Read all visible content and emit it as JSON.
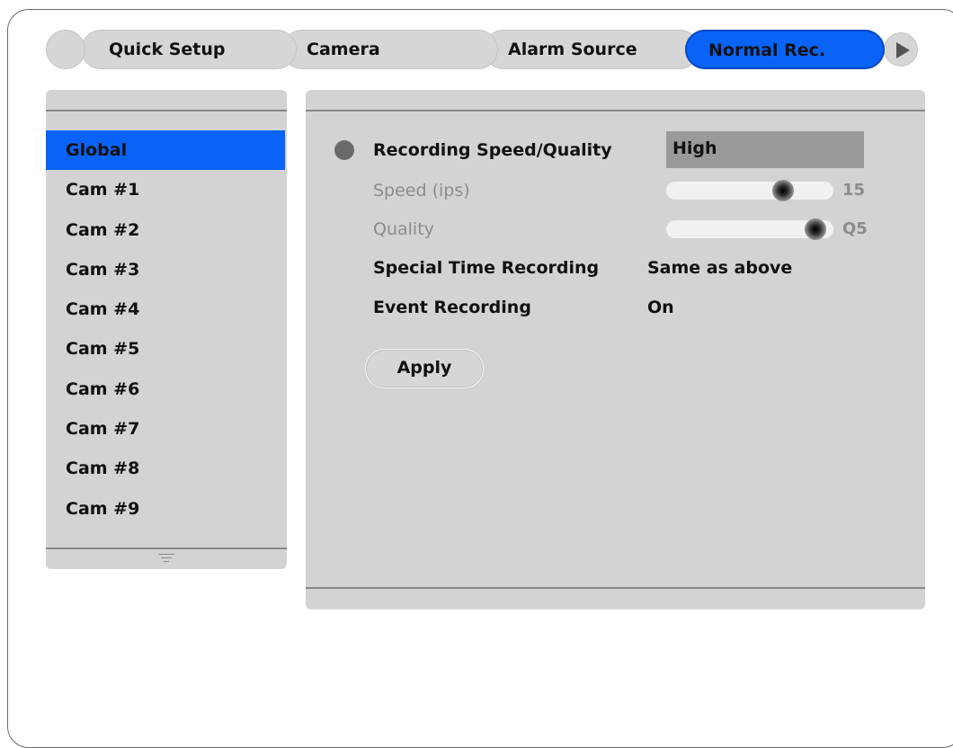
{
  "tabs": [
    {
      "label": "Quick Setup"
    },
    {
      "label": "Camera"
    },
    {
      "label": "Alarm Source"
    },
    {
      "label": "Normal Rec.",
      "active": true
    }
  ],
  "sidebar": {
    "items": [
      {
        "label": "Global",
        "selected": true
      },
      {
        "label": "Cam #1"
      },
      {
        "label": "Cam #2"
      },
      {
        "label": "Cam #3"
      },
      {
        "label": "Cam #4"
      },
      {
        "label": "Cam #5"
      },
      {
        "label": "Cam #6"
      },
      {
        "label": "Cam #7"
      },
      {
        "label": "Cam #8"
      },
      {
        "label": "Cam #9"
      }
    ]
  },
  "settings": {
    "recording_speed_quality": {
      "label": "Recording Speed/Quality",
      "value": "High"
    },
    "speed": {
      "label": "Speed (ips)",
      "value": "15",
      "fraction": 0.73
    },
    "quality": {
      "label": "Quality",
      "value": "Q5",
      "fraction": 0.95
    },
    "special_time_recording": {
      "label": "Special Time Recording",
      "value": "Same as above"
    },
    "event_recording": {
      "label": "Event Recording",
      "value": "On"
    }
  },
  "apply_label": "Apply",
  "colors": {
    "accent": "#0a63f7",
    "panel": "#d3d3d3",
    "dim_text": "#8c8c8c"
  },
  "icons": {
    "next": "play-triangle-icon",
    "scroll": "scroll-down-icon",
    "bullet": "bullet-icon"
  }
}
